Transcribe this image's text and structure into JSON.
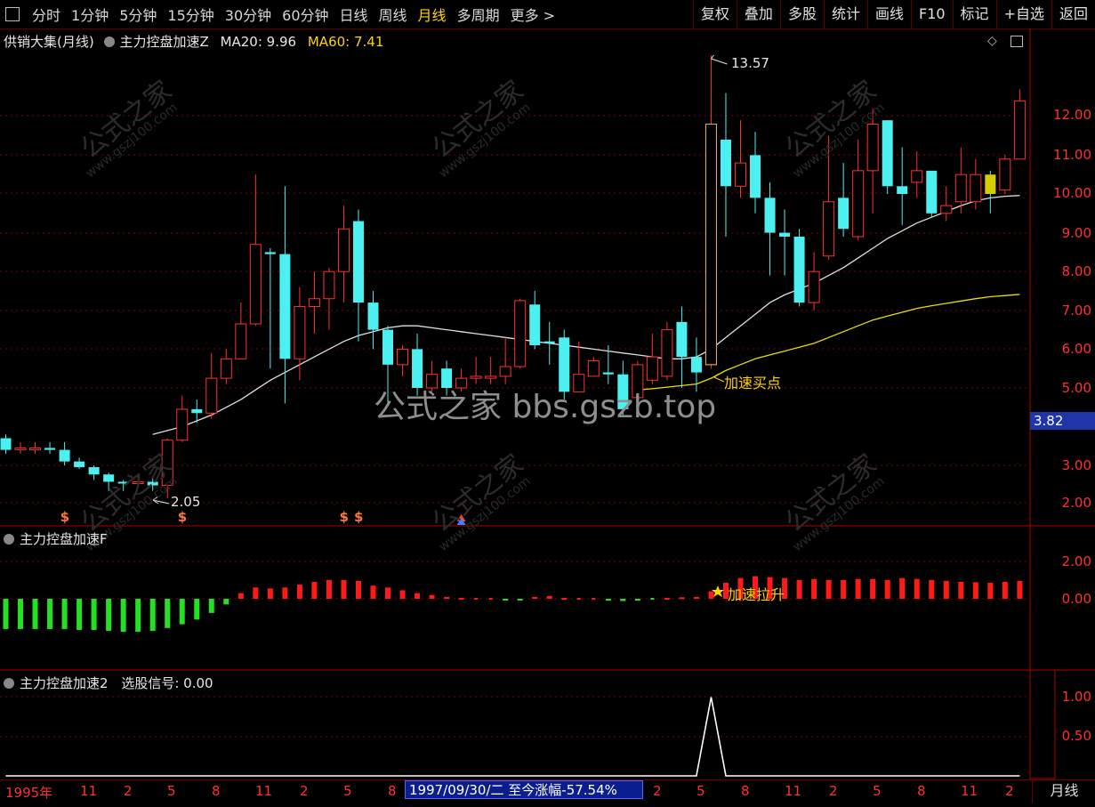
{
  "toolbar": {
    "left": [
      "分时",
      "1分钟",
      "5分钟",
      "15分钟",
      "30分钟",
      "60分钟",
      "日线",
      "周线",
      "月线",
      "多周期",
      "更多 >"
    ],
    "active": "月线",
    "right": [
      "复权",
      "叠加",
      "多股",
      "统计",
      "画线",
      "F10",
      "标记",
      "+自选",
      "返回"
    ]
  },
  "main_panel": {
    "stock": "供销大集(月线)",
    "indicator": "主力控盘加速Z",
    "ma20": "MA20: 9.96",
    "ma60": "MA60: 7.41",
    "annotation_high": "13.57",
    "annotation_low": "2.05",
    "annotation_buy": "加速买点",
    "current_price": "3.82",
    "y_labels": [
      "12.00",
      "11.00",
      "10.00",
      "9.00",
      "8.00",
      "7.00",
      "6.00",
      "5.00",
      "3.00",
      "2.00"
    ]
  },
  "panel2": {
    "title": "主力控盘加速F",
    "annotation": "加速拉升",
    "y_labels": [
      "2.00",
      "0.00"
    ]
  },
  "panel3": {
    "title": "主力控盘加速2",
    "signal": "选股信号: 0.00",
    "y_labels": [
      "1.00",
      "0.50"
    ]
  },
  "dates": {
    "labels": [
      "1995年",
      "11",
      "2",
      "5",
      "8",
      "11",
      "2",
      "5",
      "8",
      "2",
      "5",
      "8",
      "11",
      "2",
      "5",
      "8",
      "11",
      "2"
    ],
    "info": "1997/09/30/二  至今涨幅-57.54%",
    "period": "月线"
  },
  "watermark": {
    "center": "公式之家 bbs.gszb.top",
    "brand": "公式之家",
    "site": "www.gszj100.com"
  },
  "colors": {
    "up": "#ff3030",
    "down": "#4df0f0",
    "ma20": "#e0e0e0",
    "ma60": "#e8e000",
    "pos": "#ff1a1a",
    "neg": "#22e022"
  },
  "chart_data": {
    "type": "candlestick",
    "candles": [
      [
        3.7,
        3.4,
        3.8,
        3.3
      ],
      [
        3.4,
        3.45,
        3.6,
        3.3
      ],
      [
        3.4,
        3.45,
        3.6,
        3.3
      ],
      [
        3.45,
        3.4,
        3.6,
        3.3
      ],
      [
        3.4,
        3.1,
        3.6,
        3.0
      ],
      [
        3.1,
        2.95,
        3.2,
        2.9
      ],
      [
        2.95,
        2.75,
        3.0,
        2.6
      ],
      [
        2.75,
        2.55,
        2.8,
        2.3
      ],
      [
        2.55,
        2.5,
        2.6,
        2.3
      ],
      [
        2.5,
        2.55,
        2.7,
        2.4
      ],
      [
        2.55,
        2.45,
        2.7,
        2.3
      ],
      [
        2.45,
        3.65,
        3.7,
        2.1
      ],
      [
        3.65,
        4.45,
        4.8,
        3.6
      ],
      [
        4.45,
        4.35,
        4.7,
        4.1
      ],
      [
        4.35,
        5.25,
        5.9,
        4.2
      ],
      [
        5.25,
        5.75,
        6.0,
        5.1
      ],
      [
        5.75,
        6.65,
        7.2,
        5.8
      ],
      [
        6.65,
        8.7,
        10.5,
        6.6
      ],
      [
        8.5,
        8.45,
        8.6,
        5.5
      ],
      [
        8.45,
        5.75,
        10.2,
        4.6
      ],
      [
        5.75,
        7.1,
        7.6,
        5.2
      ],
      [
        7.1,
        7.3,
        8.0,
        6.4
      ],
      [
        7.3,
        8.0,
        8.1,
        6.5
      ],
      [
        8.0,
        9.1,
        9.7,
        7.2
      ],
      [
        9.3,
        7.2,
        9.6,
        6.2
      ],
      [
        7.2,
        6.5,
        7.5,
        6.0
      ],
      [
        6.5,
        5.6,
        6.6,
        4.6
      ],
      [
        5.6,
        6.0,
        6.1,
        5.3
      ],
      [
        6.0,
        5.0,
        6.4,
        4.8
      ],
      [
        5.0,
        5.35,
        5.7,
        4.9
      ],
      [
        5.5,
        5.0,
        5.7,
        4.8
      ],
      [
        5.0,
        5.25,
        5.5,
        4.9
      ],
      [
        5.25,
        5.3,
        5.8,
        5.1
      ],
      [
        5.25,
        5.3,
        5.8,
        5.1
      ],
      [
        5.3,
        5.55,
        6.3,
        5.1
      ],
      [
        5.55,
        7.25,
        7.3,
        5.5
      ],
      [
        7.15,
        6.1,
        7.5,
        6.0
      ],
      [
        6.2,
        6.15,
        6.7,
        5.6
      ],
      [
        6.3,
        4.9,
        6.5,
        4.7
      ],
      [
        4.9,
        5.35,
        6.2,
        5.0
      ],
      [
        5.3,
        5.7,
        5.8,
        5.4
      ],
      [
        5.4,
        5.35,
        6.1,
        5.1
      ],
      [
        5.35,
        4.45,
        5.7,
        4.3
      ],
      [
        4.75,
        5.6,
        5.7,
        4.3
      ],
      [
        5.2,
        5.8,
        6.4,
        5.1
      ],
      [
        5.3,
        6.5,
        6.7,
        5.2
      ],
      [
        6.7,
        5.8,
        7.1,
        5.0
      ],
      [
        5.8,
        5.4,
        6.3,
        4.9
      ],
      [
        5.6,
        11.8,
        13.57,
        5.5
      ],
      [
        11.4,
        10.2,
        12.6,
        8.9
      ],
      [
        10.2,
        10.8,
        11.9,
        9.9
      ],
      [
        11.0,
        9.9,
        11.6,
        9.5
      ],
      [
        9.9,
        9.0,
        10.3,
        7.9
      ],
      [
        9.0,
        8.9,
        9.6,
        7.9
      ],
      [
        8.9,
        7.2,
        9.1,
        7.1
      ],
      [
        7.2,
        8.0,
        8.5,
        7.0
      ],
      [
        8.4,
        9.8,
        11.5,
        8.3
      ],
      [
        9.9,
        9.1,
        10.8,
        8.9
      ],
      [
        8.9,
        10.6,
        11.4,
        8.8
      ],
      [
        10.6,
        11.8,
        12.2,
        9.5
      ],
      [
        11.9,
        10.2,
        11.9,
        10.0
      ],
      [
        10.2,
        10.0,
        11.2,
        9.2
      ],
      [
        10.3,
        10.6,
        11.1,
        9.9
      ],
      [
        10.6,
        9.5,
        10.5,
        9.4
      ],
      [
        9.5,
        9.7,
        10.2,
        9.3
      ],
      [
        9.8,
        10.5,
        11.2,
        9.5
      ],
      [
        9.8,
        10.5,
        10.9,
        9.6
      ],
      [
        10.5,
        10.0,
        10.6,
        9.5
      ],
      [
        10.1,
        10.9,
        11.0,
        10.0
      ],
      [
        10.9,
        12.4,
        12.7,
        10.9
      ]
    ],
    "ma20": [
      null,
      null,
      null,
      null,
      null,
      null,
      null,
      null,
      null,
      null,
      3.8,
      3.9,
      4.0,
      4.15,
      4.3,
      4.5,
      4.7,
      4.95,
      5.2,
      5.4,
      5.6,
      5.8,
      6.0,
      6.2,
      6.35,
      6.45,
      6.55,
      6.6,
      6.6,
      6.55,
      6.5,
      6.45,
      6.4,
      6.35,
      6.3,
      6.25,
      6.2,
      6.15,
      6.1,
      6.05,
      6.0,
      5.95,
      5.9,
      5.85,
      5.8,
      5.75,
      5.75,
      5.8,
      6.0,
      6.3,
      6.6,
      6.9,
      7.2,
      7.4,
      7.55,
      7.7,
      7.9,
      8.1,
      8.35,
      8.6,
      8.85,
      9.05,
      9.25,
      9.4,
      9.55,
      9.7,
      9.82,
      9.9,
      9.94,
      9.96
    ],
    "ma60": [
      null,
      null,
      null,
      null,
      null,
      null,
      null,
      null,
      null,
      null,
      null,
      null,
      null,
      null,
      null,
      null,
      null,
      null,
      null,
      null,
      null,
      null,
      null,
      null,
      null,
      null,
      null,
      null,
      null,
      null,
      null,
      null,
      null,
      null,
      null,
      null,
      null,
      null,
      null,
      null,
      null,
      null,
      null,
      4.95,
      4.98,
      5.02,
      5.06,
      5.1,
      5.25,
      5.45,
      5.6,
      5.75,
      5.85,
      5.95,
      6.05,
      6.15,
      6.3,
      6.45,
      6.6,
      6.75,
      6.85,
      6.95,
      7.05,
      7.12,
      7.18,
      7.24,
      7.3,
      7.35,
      7.38,
      7.41
    ],
    "f_values": [
      -1.6,
      -1.6,
      -1.6,
      -1.6,
      -1.6,
      -1.65,
      -1.65,
      -1.7,
      -1.75,
      -1.75,
      -1.7,
      -1.55,
      -1.35,
      -1.1,
      -0.75,
      -0.3,
      0.3,
      0.6,
      0.55,
      0.6,
      0.75,
      0.9,
      1.0,
      1.0,
      0.95,
      0.7,
      0.6,
      0.45,
      0.3,
      0.2,
      0.1,
      0.05,
      0.03,
      0.02,
      -0.05,
      -0.05,
      0.1,
      0.15,
      0.05,
      0.02,
      0.0,
      -0.1,
      -0.12,
      -0.1,
      -0.02,
      0.05,
      0.08,
      0.1,
      0.4,
      0.85,
      1.1,
      1.2,
      1.15,
      1.1,
      1.0,
      1.05,
      1.0,
      1.0,
      1.05,
      1.05,
      1.0,
      1.1,
      1.05,
      1.0,
      0.95,
      0.9,
      0.88,
      0.85,
      0.9,
      0.95
    ],
    "signal": [
      0,
      0,
      0,
      0,
      0,
      0,
      0,
      0,
      0,
      0,
      0,
      0,
      0,
      0,
      0,
      0,
      0,
      0,
      0,
      0,
      0,
      0,
      0,
      0,
      0,
      0,
      0,
      0,
      0,
      0,
      0,
      0,
      0,
      0,
      0,
      0,
      0,
      0,
      0,
      0,
      0,
      0,
      0,
      0,
      0,
      0,
      0,
      0,
      1,
      0,
      0,
      0,
      0,
      0,
      0,
      0,
      0,
      0,
      0,
      0,
      0,
      0,
      0,
      0,
      0,
      0,
      0,
      0,
      0,
      0
    ],
    "markers": [
      {
        "index": 4,
        "glyph": "$"
      },
      {
        "index": 12,
        "glyph": "$"
      },
      {
        "index": 23,
        "glyph": "$"
      },
      {
        "index": 24,
        "glyph": "$"
      },
      {
        "index": 31,
        "glyph": "^"
      }
    ]
  }
}
